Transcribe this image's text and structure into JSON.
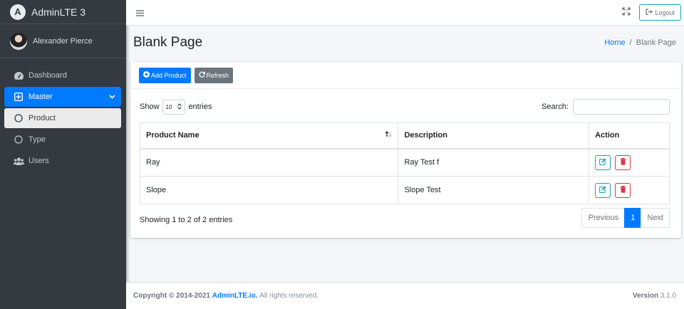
{
  "brand": {
    "name": "AdminLTE 3",
    "logo_letter": "A"
  },
  "user": {
    "name": "Alexander Pierce"
  },
  "sidebar": {
    "items": [
      {
        "label": "Dashboard",
        "icon": "tachometer-icon"
      },
      {
        "label": "Master",
        "icon": "plus-square-icon"
      },
      {
        "label": "Product",
        "icon": "circle-icon"
      },
      {
        "label": "Type",
        "icon": "circle-icon"
      },
      {
        "label": "Users",
        "icon": "users-icon"
      }
    ]
  },
  "topbar": {
    "logout_label": "Logout"
  },
  "header": {
    "title": "Blank Page",
    "breadcrumb_home": "Home",
    "breadcrumb_sep": "/",
    "breadcrumb_current": "Blank Page"
  },
  "card": {
    "add_label": "Add Product",
    "refresh_label": "Refresh",
    "show_label": "Show",
    "entries_value": "10",
    "entries_label": "entries",
    "search_label": "Search:",
    "search_value": ""
  },
  "table": {
    "headers": [
      "Product Name",
      "Description",
      "Action"
    ],
    "rows": [
      {
        "name": "Ray",
        "description": "Ray Test f"
      },
      {
        "name": "Slope",
        "description": "Slope Test"
      }
    ]
  },
  "pagination": {
    "info": "Showing 1 to 2 of 2 entries",
    "previous": "Previous",
    "page": "1",
    "next": "Next"
  },
  "footer": {
    "copyright": "Copyright © 2014-2021",
    "link": "AdminLTE.io.",
    "rights": "All rights reserved.",
    "version_label": "Version",
    "version": "3.1.0"
  },
  "colors": {
    "primary": "#007bff",
    "sidebar_bg": "#343a40",
    "info": "#17a2b8",
    "danger": "#dc3545"
  }
}
